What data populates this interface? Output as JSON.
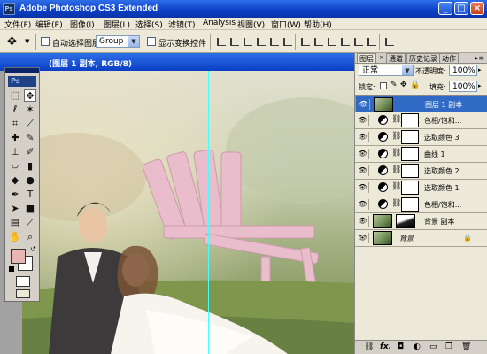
{
  "app": {
    "title": "Adobe Photoshop CS3 Extended",
    "logo_text": "Ps",
    "window_buttons": [
      "_",
      "□",
      "×"
    ]
  },
  "menu": [
    "文件(F)",
    "编辑(E)",
    "图像(I)",
    "图层(L)",
    "选择(S)",
    "滤镜(T)",
    "Analysis",
    "视图(V)",
    "窗口(W)",
    "帮助(H)"
  ],
  "options": {
    "tool_icon": "move-tool-icon",
    "auto_select_label": "自动选择图层",
    "auto_select_value": "Group",
    "show_transform_label": "显示变换控件"
  },
  "document": {
    "title": "(图层 1 副本, RGB/8)"
  },
  "toolbox": {
    "logo": "Ps"
  },
  "layers_panel": {
    "tabs": [
      "图层",
      "通道",
      "历史记录",
      "动作"
    ],
    "blend_mode": "正常",
    "opacity_label": "不透明度:",
    "opacity_value": "100%",
    "lock_label": "锁定:",
    "fill_label": "填充:",
    "fill_value": "100%",
    "layers": [
      {
        "name": "图层 1 副本",
        "type": "pixel",
        "selected": true
      },
      {
        "name": "色相/饱和...",
        "type": "adjustment"
      },
      {
        "name": "选取颜色 3",
        "type": "adjustment"
      },
      {
        "name": "曲线 1",
        "type": "adjustment"
      },
      {
        "name": "选取颜色 2",
        "type": "adjustment"
      },
      {
        "name": "选取颜色 1",
        "type": "adjustment"
      },
      {
        "name": "色相/饱和...",
        "type": "adjustment"
      },
      {
        "name": "背景 副本",
        "type": "masked"
      },
      {
        "name": "背景",
        "type": "background",
        "locked": true
      }
    ],
    "footer_icons": [
      "link-icon",
      "fx-icon",
      "mask-icon",
      "adjustment-icon",
      "folder-icon",
      "new-layer-icon",
      "trash-icon"
    ],
    "footer_fx": "fx."
  },
  "colors": {
    "foreground": "#e8b4b4",
    "background": "#ffffff",
    "titlebar": "#0a3fc4",
    "selection": "#316ac5"
  }
}
